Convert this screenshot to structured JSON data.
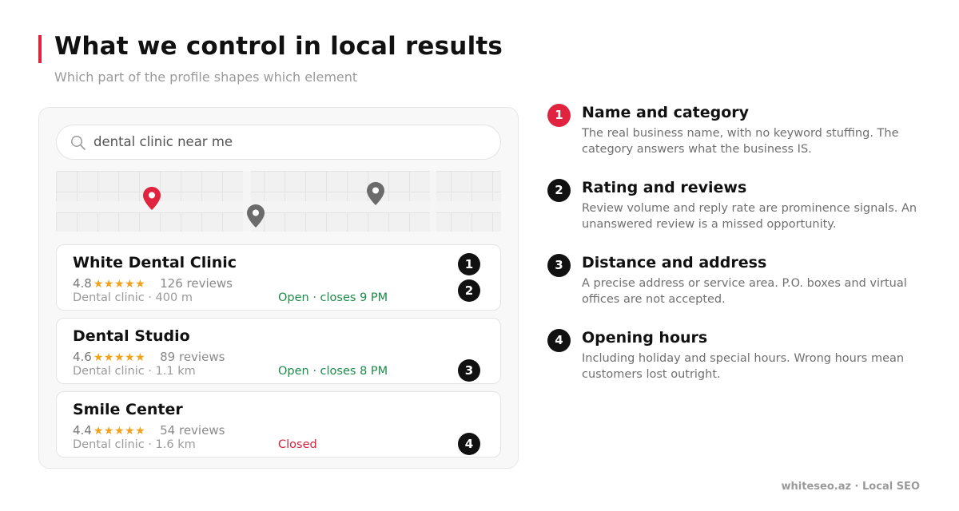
{
  "header": {
    "title": "What we control in local results",
    "subtitle": "Which part of the profile shapes which element"
  },
  "colors": {
    "accent": "#e0243f",
    "open": "#1e8a4a",
    "closed": "#d6233c",
    "star": "#f0a21b",
    "pin_main": "#e0243f",
    "pin_other": "#6b6b6b"
  },
  "search": {
    "icon": "search-icon",
    "value": "dental clinic near me"
  },
  "map": {
    "pins": [
      "map-pin-icon",
      "map-pin-icon",
      "map-pin-icon"
    ]
  },
  "results": [
    {
      "name": "White Dental Clinic",
      "rating": "4.8",
      "stars": "★★★★★",
      "reviews": "126 reviews",
      "meta": "Dental clinic · 400 m",
      "status": "Open · closes 9 PM",
      "status_type": "open",
      "badges": [
        "1",
        "2"
      ]
    },
    {
      "name": "Dental Studio",
      "rating": "4.6",
      "stars": "★★★★★",
      "reviews": "89 reviews",
      "meta": "Dental clinic · 1.1 km",
      "status": "Open · closes 8 PM",
      "status_type": "open",
      "badges": [
        "3"
      ]
    },
    {
      "name": "Smile Center",
      "rating": "4.4",
      "stars": "★★★★★",
      "reviews": "54 reviews",
      "meta": "Dental clinic · 1.6 km",
      "status": "Closed",
      "status_type": "closed",
      "badges": [
        "4"
      ]
    }
  ],
  "legend": [
    {
      "number": "1",
      "title": "Name and category",
      "description": "The real business name, with no keyword stuffing. The category answers what the business IS."
    },
    {
      "number": "2",
      "title": "Rating and reviews",
      "description": "Review volume and reply rate are prominence signals. An unanswered review is a missed opportunity."
    },
    {
      "number": "3",
      "title": "Distance and address",
      "description": "A precise address or service area. P.O. boxes and virtual offices are not accepted."
    },
    {
      "number": "4",
      "title": "Opening hours",
      "description": "Including holiday and special hours. Wrong hours mean customers lost outright."
    }
  ],
  "footer": {
    "text": "whiteseo.az · Local SEO"
  }
}
